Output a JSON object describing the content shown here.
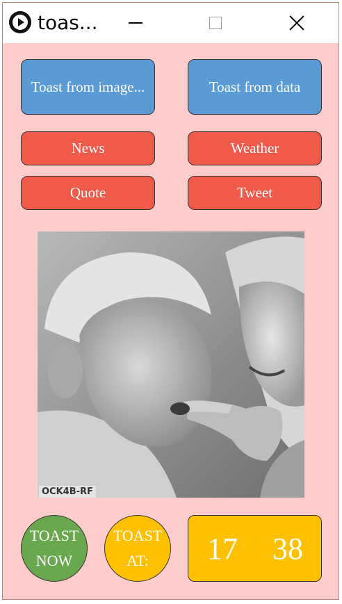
{
  "window": {
    "title": "toas...",
    "controls": {
      "minimize": "minimize-icon",
      "maximize": "maximize-icon",
      "close": "close-icon"
    }
  },
  "buttons": {
    "toast_from_image": "Toast from image...",
    "toast_from_data": "Toast from data",
    "news": "News",
    "weather": "Weather",
    "quote": "Quote",
    "tweet": "Tweet"
  },
  "photo": {
    "watermark": "OCK4B-RF"
  },
  "footer": {
    "toast_now": [
      "TOAST",
      "NOW"
    ],
    "toast_at": [
      "TOAST",
      "AT:"
    ],
    "hour": "17",
    "minute": "38"
  },
  "colors": {
    "background": "#ffcccc",
    "blue_button": "#5b9bd5",
    "red_button": "#f05a4a",
    "green_circle": "#6aa84f",
    "yellow": "#ffc000"
  }
}
